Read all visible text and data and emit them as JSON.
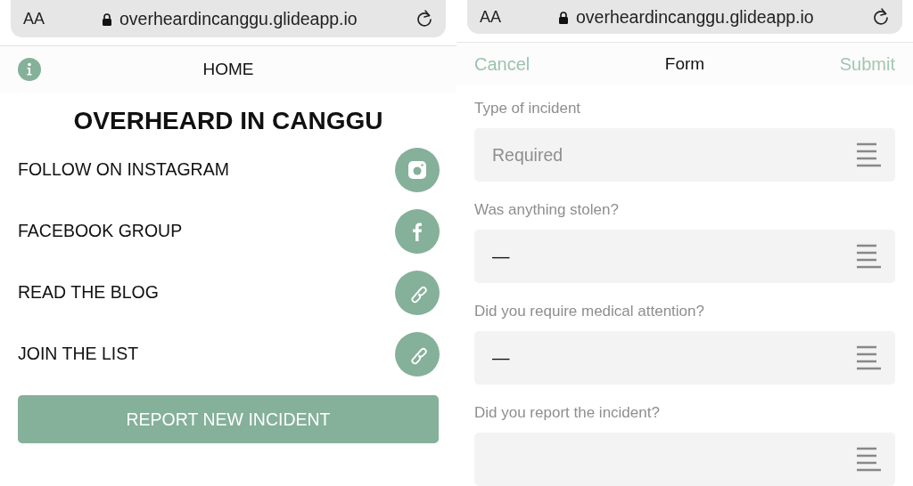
{
  "screens": [
    {
      "browser": {
        "text_size": "AA",
        "url": "overheardincanggu.glideapp.io"
      },
      "header": {
        "title": "HOME"
      },
      "heading": "OVERHEARD IN CANGGU",
      "links": [
        {
          "label": "FOLLOW ON INSTAGRAM",
          "kind": "instagram"
        },
        {
          "label": "FACEBOOK GROUP",
          "kind": "facebook"
        },
        {
          "label": "READ THE BLOG",
          "kind": "link"
        },
        {
          "label": "JOIN THE LIST",
          "kind": "link"
        }
      ],
      "button": "REPORT NEW INCIDENT"
    },
    {
      "browser": {
        "text_size": "AA",
        "url": "overheardincanggu.glideapp.io"
      },
      "header": {
        "cancel": "Cancel",
        "title": "Form",
        "submit": "Submit",
        "submit_disabled": true
      },
      "fields": [
        {
          "label": "Type of incident",
          "placeholder": "Required"
        },
        {
          "label": "Was anything stolen?",
          "value": "—"
        },
        {
          "label": "Did you require medical attention?",
          "value": "—"
        },
        {
          "label": "Did you report the incident?"
        }
      ]
    }
  ]
}
